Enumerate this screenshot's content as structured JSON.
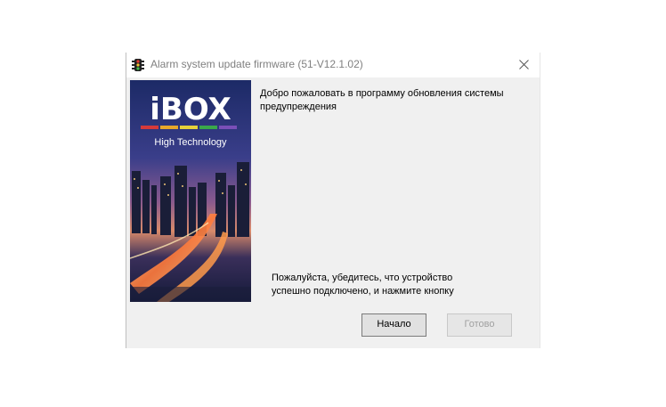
{
  "window": {
    "title": "Alarm system update firmware (51-V12.1.02)"
  },
  "banner": {
    "brand": "iBOX",
    "tagline": "High Technology",
    "stripe_colors": [
      "#d63a3a",
      "#e8a82a",
      "#e6d23a",
      "#3aa84a",
      "#7a4fb8"
    ]
  },
  "content": {
    "welcome_line1": "Добро пожаловать в программу обновления системы",
    "welcome_line2": "предупреждения",
    "note_line1": "Пожалуйста, убедитесь, что устройство",
    "note_line2": "успешно подключено, и нажмите кнопку"
  },
  "buttons": {
    "start_label": "Начало",
    "done_label": "Готово"
  }
}
